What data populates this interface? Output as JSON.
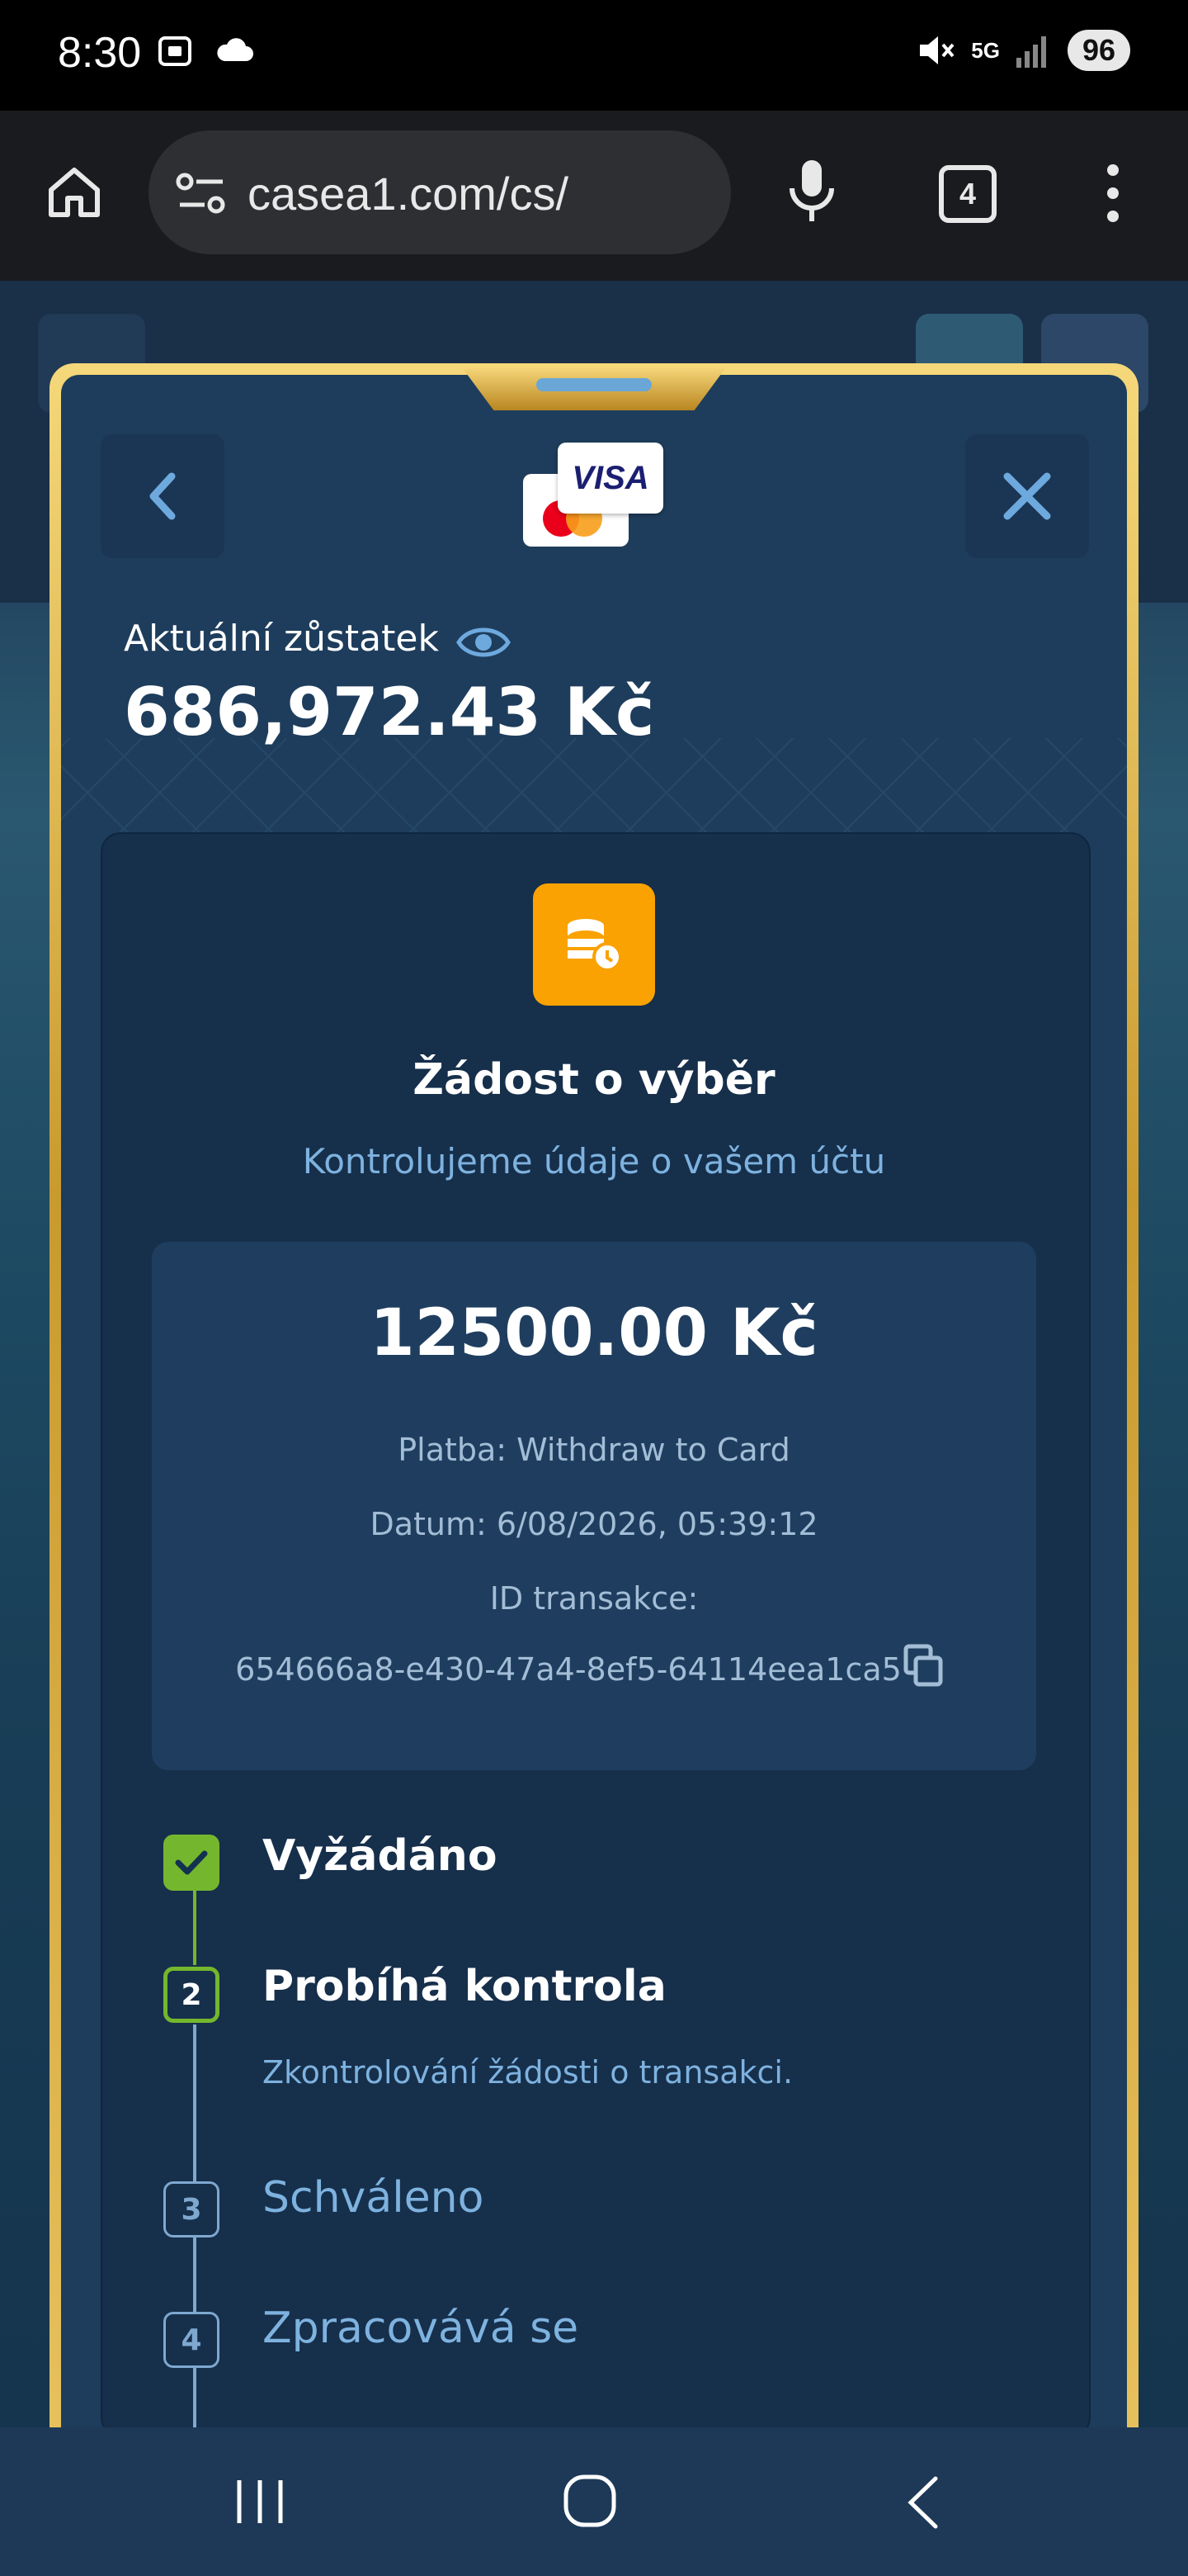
{
  "status_bar": {
    "time": "8:30",
    "network": "5G",
    "battery": "96"
  },
  "browser": {
    "url": "casea1.com/cs/",
    "tab_count": "4"
  },
  "modal": {
    "card_brand": "VISA",
    "balance_label": "Aktuální zůstatek",
    "balance_amount": "686,972.43 Kč",
    "request_title": "Žádost o výběr",
    "request_subtitle": "Kontrolujeme údaje o vašem účtu",
    "details": {
      "amount": "12500.00 Kč",
      "payment": "Platba: Withdraw to Card",
      "date": "Datum: 6/08/2026, 05:39:12",
      "txid_label": "ID transakce:",
      "txid": "654666a8-e430-47a4-8ef5-64114eea1ca5"
    },
    "steps": [
      {
        "number": "1",
        "label": "Vyžádáno",
        "state": "done"
      },
      {
        "number": "2",
        "label": "Probíhá kontrola",
        "state": "active",
        "description": "Zkontrolování žádosti o transakci."
      },
      {
        "number": "3",
        "label": "Schváleno",
        "state": "pending"
      },
      {
        "number": "4",
        "label": "Zpracovává se",
        "state": "pending"
      }
    ]
  },
  "colors": {
    "accent_orange": "#f9a202",
    "done_green": "#74b72e",
    "gold_frame": "#e7c15d",
    "panel_blue": "#1e3d5c",
    "muted_blue_text": "#7eb2df"
  }
}
